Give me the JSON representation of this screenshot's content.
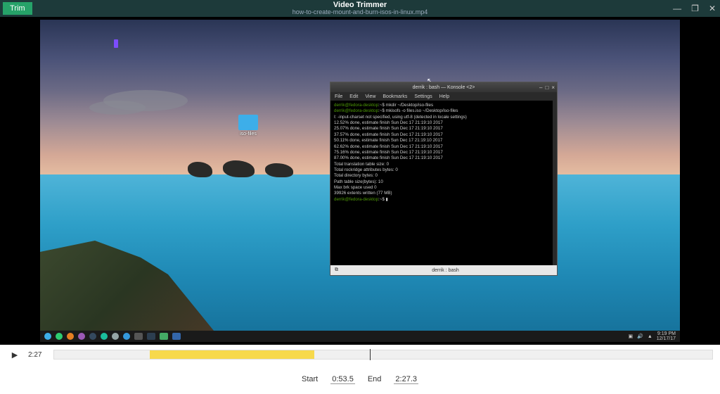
{
  "header": {
    "trim_label": "Trim",
    "app_title": "Video Trimmer",
    "file_name": "how-to-create-mount-and-burn-isos-in-linux.mp4",
    "win_min": "—",
    "win_max": "❐",
    "win_close": "✕"
  },
  "desktop": {
    "folder_label": "iso-files"
  },
  "terminal": {
    "title": "derrik : bash — Konsole <2>",
    "win_min": "–",
    "win_max": "□",
    "win_close": "×",
    "menu": [
      "File",
      "Edit",
      "View",
      "Bookmarks",
      "Settings",
      "Help"
    ],
    "lines": [
      {
        "prompt": "derrik@fedora-desktop",
        "cmd": ":~$ mkdir ~/Desktop/iso-files"
      },
      {
        "prompt": "derrik@fedora-desktop",
        "cmd": ":~$ mkisofs -o files.iso ~/Desktop/iso-files"
      },
      {
        "plain": "I: -input-charset not specified, using utf-8 (detected in locale settings)"
      },
      {
        "plain": "  12.52% done, estimate finish Sun Dec 17 21:19:10 2017"
      },
      {
        "plain": "  25.07% done, estimate finish Sun Dec 17 21:19:10 2017"
      },
      {
        "plain": "  37.57% done, estimate finish Sun Dec 17 21:19:10 2017"
      },
      {
        "plain": "  50.11% done, estimate finish Sun Dec 17 21:19:10 2017"
      },
      {
        "plain": "  62.62% done, estimate finish Sun Dec 17 21:19:10 2017"
      },
      {
        "plain": "  75.16% done, estimate finish Sun Dec 17 21:19:10 2017"
      },
      {
        "plain": "  87.00% done, estimate finish Sun Dec 17 21:19:10 2017"
      },
      {
        "plain": "Total translation table size: 0"
      },
      {
        "plain": "Total rockridge attributes bytes: 0"
      },
      {
        "plain": "Total directory bytes: 0"
      },
      {
        "plain": "Path table size(bytes): 10"
      },
      {
        "plain": "Max brk space used 0"
      },
      {
        "plain": "39926 extents written (77 MB)"
      },
      {
        "prompt": "derrik@fedora-desktop",
        "cmd": ":~$ ▮"
      }
    ],
    "status_left": "⧉",
    "status_center": "derrik : bash"
  },
  "taskbar": {
    "time": "9:19 PM",
    "date": "12/17/17",
    "tray_icons": [
      "▣",
      "🔊",
      "▲"
    ]
  },
  "playback": {
    "play_icon": "▶",
    "current_time": "2:27"
  },
  "trim_controls": {
    "start_label": "Start",
    "start_value": "0:53.5",
    "end_label": "End",
    "end_value": "2:27.3"
  }
}
